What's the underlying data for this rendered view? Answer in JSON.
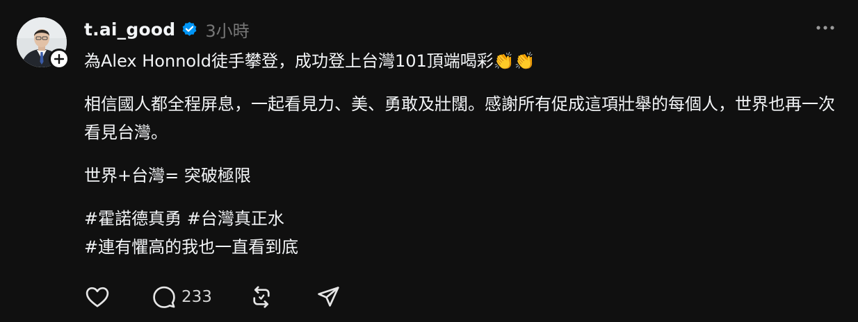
{
  "post": {
    "author": {
      "username": "t.ai_good",
      "verified": true,
      "timestamp": "3小時"
    },
    "content": {
      "line1": "為Alex Honnold徒手攀登，成功登上台灣101頂端喝彩",
      "line1_emoji": "👏👏",
      "paragraph2": "相信國人都全程屏息，一起看見力、美、勇敢及壯闊。感謝所有促成這項壯舉的每個人，世界也再一次看見台灣。",
      "paragraph3": "世界+台灣= 突破極限",
      "hashtags_line1": "#霍諾德真勇 #台灣真正水",
      "hashtags_line2": "#連有懼高的我也一直看到底"
    },
    "actions": {
      "like_count": "",
      "reply_count": "233",
      "repost_count": "",
      "share_count": ""
    },
    "icons": {
      "like": "heart-icon",
      "reply": "speech-bubble-icon",
      "repost": "repost-icon",
      "share": "send-icon",
      "more": "more-dots-icon",
      "verified": "verified-badge-icon",
      "follow": "plus-icon"
    },
    "colors": {
      "background": "#101010",
      "text": "#f3f5f7",
      "muted": "#777777",
      "verified_blue": "#0095f6"
    }
  }
}
